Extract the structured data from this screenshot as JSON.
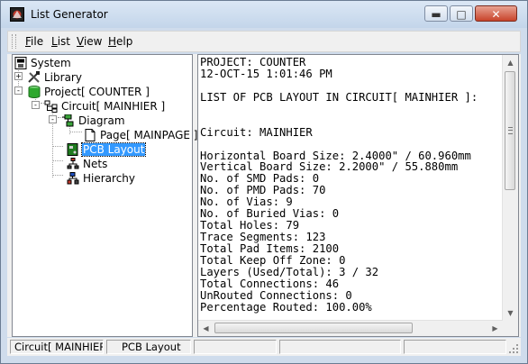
{
  "window": {
    "title": "List Generator",
    "controls": {
      "minimize": "▬",
      "maximize": "□",
      "close": "✕"
    }
  },
  "menu": {
    "items": [
      {
        "label_accel": "F",
        "label_rest": "ile"
      },
      {
        "label_accel": "L",
        "label_rest": "ist"
      },
      {
        "label_accel": "V",
        "label_rest": "iew"
      },
      {
        "label_accel": "H",
        "label_rest": "elp"
      }
    ]
  },
  "tree": {
    "nodes": [
      {
        "label": "System",
        "icon": "system-icon",
        "expander": ""
      },
      {
        "label": "Library",
        "icon": "library-tools-icon",
        "expander": "+"
      },
      {
        "label": "Project[ COUNTER ]",
        "icon": "project-database-icon",
        "expander": "-"
      },
      {
        "label": "Circuit[ MAINHIER ]",
        "icon": "circuit-hierarchy-icon",
        "expander": "-"
      },
      {
        "label": "Diagram",
        "icon": "diagram-icon",
        "expander": "-"
      },
      {
        "label": "Page[ MAINPAGE ]",
        "icon": "page-icon",
        "expander": ""
      },
      {
        "label": "PCB Layout",
        "icon": "pcb-layout-icon",
        "expander": "",
        "selected": true
      },
      {
        "label": "Nets",
        "icon": "nets-icon",
        "expander": ""
      },
      {
        "label": "Hierarchy",
        "icon": "hierarchy-icon",
        "expander": ""
      }
    ]
  },
  "report": {
    "lines": [
      "PROJECT: COUNTER",
      "12-OCT-15 1:01:46 PM",
      "",
      "LIST OF PCB LAYOUT IN CIRCUIT[ MAINHIER ]:",
      "",
      "",
      "Circuit: MAINHIER",
      "",
      "Horizontal Board Size: 2.4000\" / 60.960mm",
      "Vertical Board Size: 2.2000\" / 55.880mm",
      "No. of SMD Pads: 0",
      "No. of PMD Pads: 70",
      "No. of Vias: 9",
      "No. of Buried Vias: 0",
      "Total Holes: 79",
      "Trace Segments: 123",
      "Total Pad Items: 2100",
      "Total Keep Off Zone: 0",
      "Layers (Used/Total): 3 / 32",
      "Total Connections: 46",
      "UnRouted Connections: 0",
      "Percentage Routed: 100.00%"
    ]
  },
  "scrollbars": {
    "up": "▲",
    "down": "▼",
    "left": "◀",
    "right": "▶"
  },
  "status": {
    "pane1": "Circuit[ MAINHIER ]",
    "pane2": "PCB Layout",
    "pane3": "",
    "pane4": "",
    "pane5": ""
  }
}
